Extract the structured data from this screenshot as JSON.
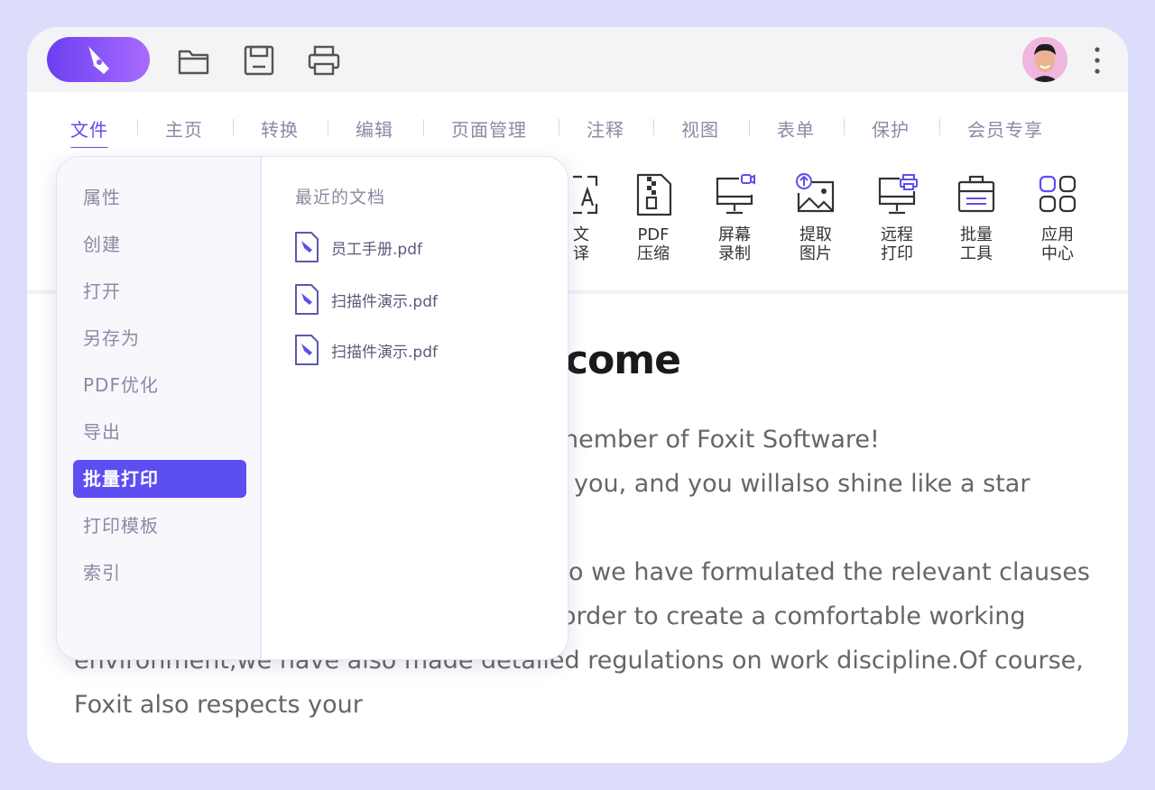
{
  "menu": {
    "tabs": [
      {
        "label": "文件"
      },
      {
        "label": "主页"
      },
      {
        "label": "转换"
      },
      {
        "label": "编辑"
      },
      {
        "label": "页面管理"
      },
      {
        "label": "注释"
      },
      {
        "label": "视图"
      },
      {
        "label": "表单"
      },
      {
        "label": "保护"
      },
      {
        "label": "会员专享"
      }
    ],
    "active_tab": "文件"
  },
  "ribbon": {
    "items": [
      {
        "label": "文\n译",
        "icon": "translate-icon"
      },
      {
        "label": "PDF\n压缩",
        "icon": "compress-icon"
      },
      {
        "label": "屏幕\n录制",
        "icon": "screen-record-icon"
      },
      {
        "label": "提取\n图片",
        "icon": "extract-image-icon"
      },
      {
        "label": "远程\n打印",
        "icon": "remote-print-icon"
      },
      {
        "label": "批量\n工具",
        "icon": "batch-tool-icon"
      },
      {
        "label": "应用\n中心",
        "icon": "app-center-icon"
      }
    ]
  },
  "file_menu": {
    "items": [
      {
        "label": "属性"
      },
      {
        "label": "创建"
      },
      {
        "label": "打开"
      },
      {
        "label": "另存为"
      },
      {
        "label": "PDF优化"
      },
      {
        "label": "导出"
      },
      {
        "label": "批量打印"
      },
      {
        "label": "打印模板"
      },
      {
        "label": "索引"
      }
    ],
    "active_item": "批量打印",
    "recent_heading": "最近的文档",
    "recent_files": [
      {
        "name": "员工手册.pdf"
      },
      {
        "name": "扫描件演示.pdf"
      },
      {
        "name": "扫描件演示.pdf"
      }
    ]
  },
  "document": {
    "title": "come",
    "lines": [
      "nember of Foxit Software!",
      "you, and you willalso shine like a star",
      "o we have formulated the relevant clauses",
      "order to create a comfortable working",
      "environment,we have also made detailed regulations on work discipline.Of course,",
      "Foxit also respects your"
    ]
  },
  "colors": {
    "accent": "#5c4ef0",
    "background": "#dcdcfb",
    "muted_text": "#8b8aa4"
  }
}
